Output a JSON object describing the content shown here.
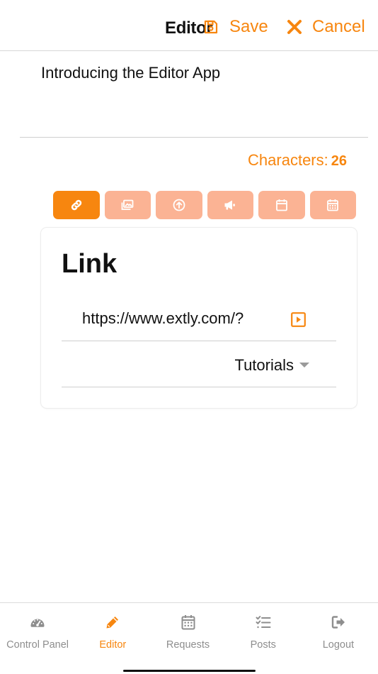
{
  "header": {
    "title": "Editor",
    "save_label": "Save",
    "cancel_label": "Cancel"
  },
  "message": {
    "text": "Introducing the Editor App"
  },
  "counter": {
    "label": "Characters:",
    "value": "26"
  },
  "toolbar": {
    "buttons": [
      {
        "icon": "link-icon",
        "active": true
      },
      {
        "icon": "images-icon",
        "active": false
      },
      {
        "icon": "upload-icon",
        "active": false
      },
      {
        "icon": "megaphone-icon",
        "active": false
      },
      {
        "icon": "calendar-icon",
        "active": false
      },
      {
        "icon": "calendar-grid-icon",
        "active": false
      }
    ]
  },
  "link_card": {
    "title": "Link",
    "url_value": "https://www.extly.com/?",
    "select_value": "Tutorials"
  },
  "tabbar": {
    "items": [
      {
        "label": "Control Panel",
        "icon": "dashboard-icon",
        "active": false
      },
      {
        "label": "Editor",
        "icon": "pencil-icon",
        "active": true
      },
      {
        "label": "Requests",
        "icon": "calendar-icon",
        "active": false
      },
      {
        "label": "Posts",
        "icon": "checklist-icon",
        "active": false
      },
      {
        "label": "Logout",
        "icon": "logout-icon",
        "active": false
      }
    ]
  },
  "colors": {
    "accent": "#f7860f",
    "accent_light": "#fbb394",
    "tab_inactive": "#8e8e8e"
  }
}
